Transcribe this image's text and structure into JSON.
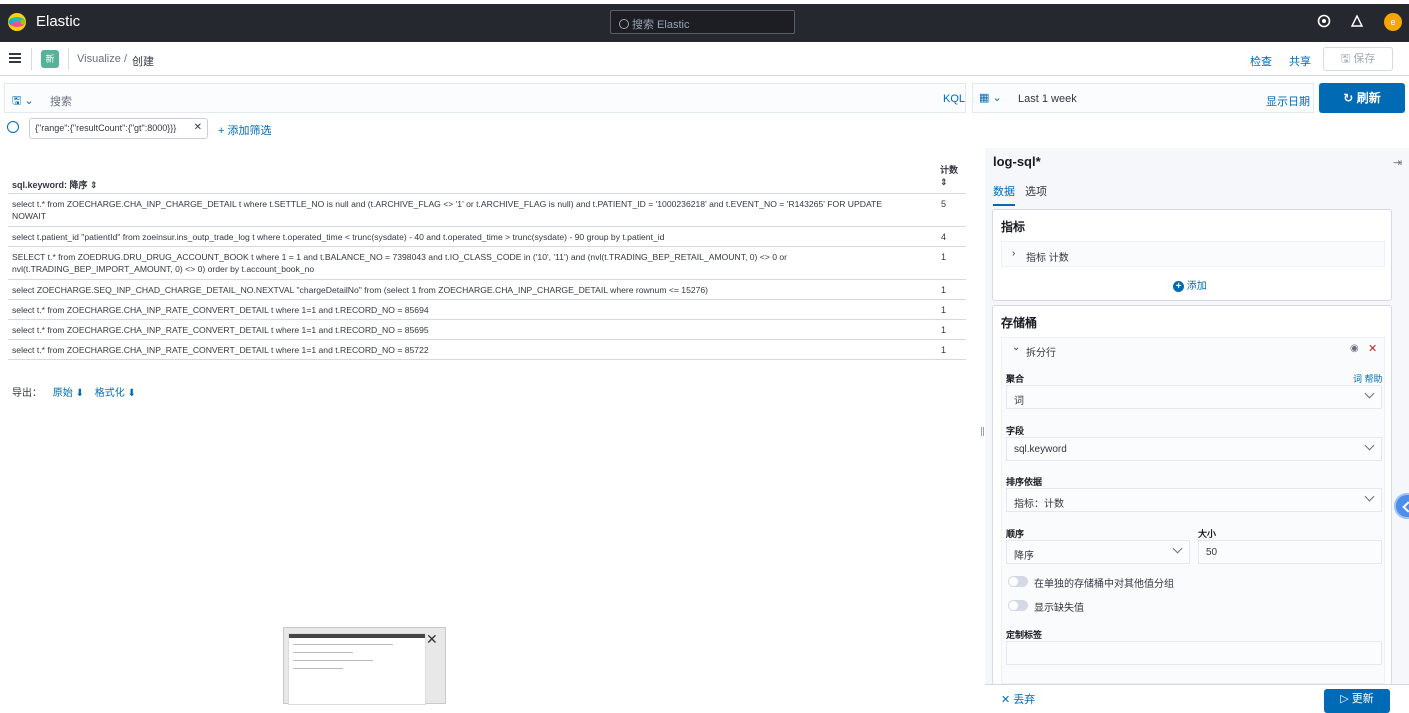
{
  "header": {
    "brand": "Elastic",
    "search_placeholder": "搜索 Elastic",
    "avatar_initial": "e"
  },
  "nav": {
    "app_badge": "新",
    "crumb_visualize": "Visualize",
    "crumb_sep": "/",
    "crumb_current": "创建",
    "inspect": "检查",
    "share": "共享",
    "save": "保存"
  },
  "query": {
    "placeholder": "搜索",
    "language": "KQL",
    "date_range": "Last 1 week",
    "show_dates": "显示日期",
    "refresh": "刷新"
  },
  "filters": {
    "pill": "{\"range\":{\"resultCount\":{\"gt\":8000}}}",
    "add": "+ 添加筛选"
  },
  "table": {
    "col_query": "sql.keyword: 降序 ⇕",
    "col_count": "计数",
    "col_count_sort": "⇕",
    "rows": [
      {
        "q": "select t.* from ZOECHARGE.CHA_INP_CHARGE_DETAIL t where t.SETTLE_NO is null and (t.ARCHIVE_FLAG <> '1' or t.ARCHIVE_FLAG is null) and t.PATIENT_ID = '1000236218' and t.EVENT_NO = 'R143265' FOR UPDATE NOWAIT",
        "c": "5"
      },
      {
        "q": "select t.patient_id \"patientId\" from zoeinsur.ins_outp_trade_log t where t.operated_time < trunc(sysdate) - 40 and t.operated_time > trunc(sysdate) - 90 group by t.patient_id",
        "c": "4"
      },
      {
        "q": "SELECT t.* from ZOEDRUG.DRU_DRUG_ACCOUNT_BOOK t where 1 = 1 and t.BALANCE_NO = 7398043 and t.IO_CLASS_CODE in ('10', '11') and (nvl(t.TRADING_BEP_RETAIL_AMOUNT, 0) <> 0 or nvl(t.TRADING_BEP_IMPORT_AMOUNT, 0) <> 0) order by t.account_book_no",
        "c": "1"
      },
      {
        "q": "select ZOECHARGE.SEQ_INP_CHAD_CHARGE_DETAIL_NO.NEXTVAL \"chargeDetailNo\" from (select 1 from ZOECHARGE.CHA_INP_CHARGE_DETAIL where rownum <= 15276)",
        "c": "1"
      },
      {
        "q": "select t.* from ZOECHARGE.CHA_INP_RATE_CONVERT_DETAIL t where 1=1 and t.RECORD_NO = 85694",
        "c": "1"
      },
      {
        "q": "select t.* from ZOECHARGE.CHA_INP_RATE_CONVERT_DETAIL t where 1=1 and t.RECORD_NO = 85695",
        "c": "1"
      },
      {
        "q": "select t.* from ZOECHARGE.CHA_INP_RATE_CONVERT_DETAIL t where 1=1 and t.RECORD_NO = 85722",
        "c": "1"
      }
    ],
    "export_label": "导出：",
    "export_raw": "原始",
    "export_formatted": "格式化"
  },
  "panel": {
    "title": "log-sql*",
    "tab_data": "数据",
    "tab_options": "选项",
    "metrics_title": "指标",
    "metric_item": "指标 计数",
    "add": "添加",
    "buckets_title": "存储桶",
    "bucket_item": "拆分行",
    "agg_label": "聚合",
    "agg_help": "词 帮助",
    "agg_value": "词",
    "field_label": "字段",
    "field_value": "sql.keyword",
    "orderby_label": "排序依据",
    "orderby_value": "指标：计数",
    "order_label": "顺序",
    "order_value": "降序",
    "size_label": "大小",
    "size_value": "50",
    "toggle_other": "在单独的存储桶中对其他值分组",
    "toggle_missing": "显示缺失值",
    "custom_label": "定制标签",
    "discard": "丢弃",
    "update": "更新"
  }
}
